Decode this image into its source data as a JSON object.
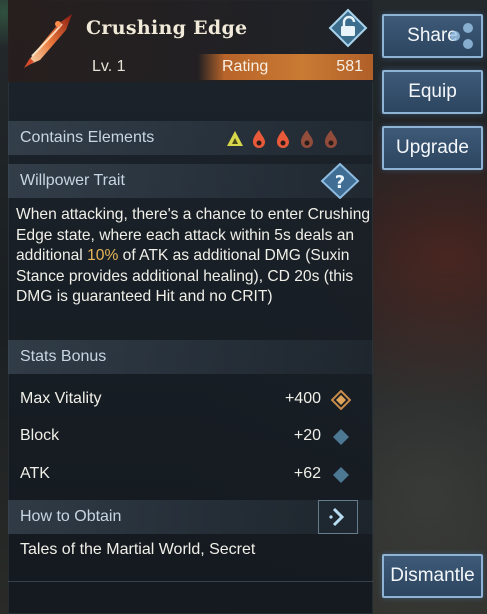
{
  "item": {
    "name": "Crushing Edge",
    "level": "Lv. 1",
    "rating_label": "Rating",
    "rating_value": "581",
    "icon": "blade-icon",
    "lock_icon": "unlock-icon"
  },
  "elements_section": {
    "label": "Contains Elements",
    "icons": [
      "earth-element-icon",
      "fire-element-icon",
      "fire-element-icon",
      "fire-element-icon-dim",
      "fire-element-icon-dim"
    ]
  },
  "willpower": {
    "label": "Willpower Trait",
    "help_icon": "question-icon",
    "desc_1": "When attacking, there's a chance to enter Crushing Edge state, where each attack within 5s deals an additional ",
    "desc_highlight": "10%",
    "desc_2": " of ATK as additional DMG (Suxin Stance provides additional healing), CD 20s (this DMG is guaranteed Hit and no CRIT)"
  },
  "stats": {
    "label": "Stats Bonus",
    "rows": [
      {
        "name": "Max Vitality",
        "value": "+400",
        "gem": "gold-diamond-icon"
      },
      {
        "name": "Block",
        "value": "+20",
        "gem": "blue-diamond-icon"
      },
      {
        "name": "ATK",
        "value": "+62",
        "gem": "blue-diamond-icon"
      }
    ]
  },
  "obtain": {
    "label": "How to Obtain",
    "text": "Tales of the Martial World, Secret",
    "arrow_icon": "arrow-right-icon"
  },
  "buttons": {
    "share": "Share",
    "equip": "Equip",
    "upgrade": "Upgrade",
    "dismantle": "Dismantle"
  },
  "colors": {
    "highlight": "#e9b65a",
    "rating_bar": "#c97a33",
    "button_border": "#8fb3d4"
  }
}
